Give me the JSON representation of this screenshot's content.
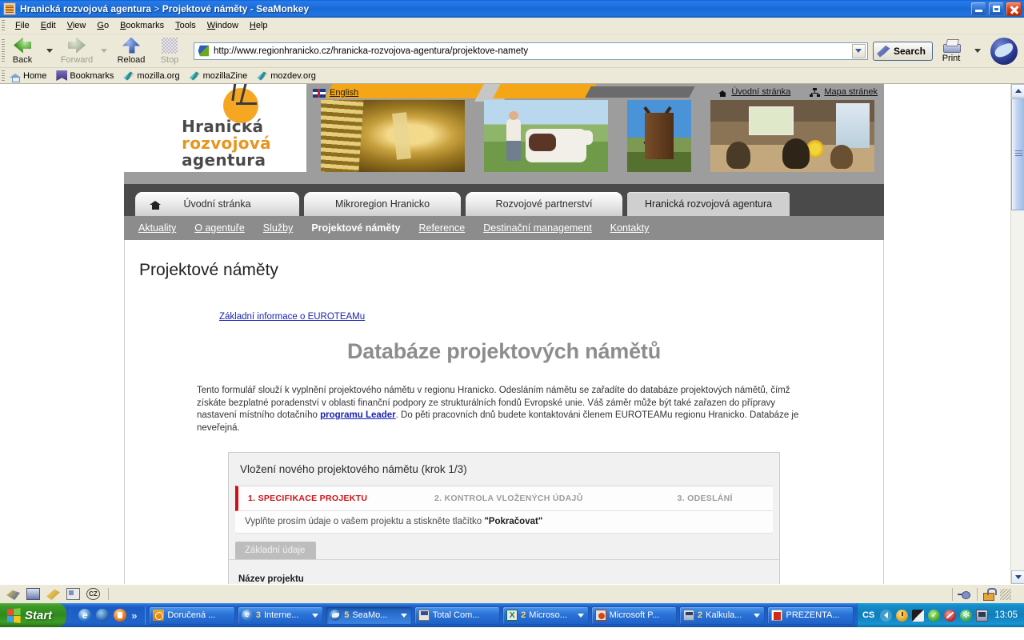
{
  "window": {
    "title_main": "Hranická rozvojová agentura",
    "title_sep": " > ",
    "title_page": "Projektové náměty - SeaMonkey",
    "icon": "app-icon"
  },
  "menubar": {
    "items": [
      {
        "label": "File"
      },
      {
        "label": "Edit"
      },
      {
        "label": "View"
      },
      {
        "label": "Go"
      },
      {
        "label": "Bookmarks"
      },
      {
        "label": "Tools"
      },
      {
        "label": "Window"
      },
      {
        "label": "Help"
      }
    ]
  },
  "toolbar": {
    "back": "Back",
    "forward": "Forward",
    "reload": "Reload",
    "stop": "Stop",
    "url": "http://www.regionhranicko.cz/hranicka-rozvojova-agentura/projektove-namety",
    "search": "Search",
    "print": "Print"
  },
  "bookmarks": {
    "items": [
      {
        "label": "Home",
        "icon": "home-icon"
      },
      {
        "label": "Bookmarks",
        "icon": "bookmark-icon"
      },
      {
        "label": "mozilla.org",
        "icon": "pencil-icon"
      },
      {
        "label": "mozillaZine",
        "icon": "pencil-icon"
      },
      {
        "label": "mozdev.org",
        "icon": "pencil-icon"
      }
    ]
  },
  "site": {
    "logo": {
      "line1": "Hranická",
      "line2": "rozvojová",
      "line3": "agentura"
    },
    "language_link": "English",
    "top_links": [
      {
        "label": "Úvodní stránka",
        "icon": "home-icon"
      },
      {
        "label": "Mapa stránek",
        "icon": "sitemap-icon"
      }
    ],
    "tabs": [
      {
        "label": "Úvodní stránka",
        "active": false,
        "icon": "home-icon"
      },
      {
        "label": "Mikroregion Hranicko",
        "active": false
      },
      {
        "label": "Rozvojové partnerství",
        "active": false
      },
      {
        "label": "Hranická rozvojová agentura",
        "active": true
      }
    ],
    "subnav": [
      {
        "label": "Aktuality",
        "current": false
      },
      {
        "label": "O agentuře",
        "current": false
      },
      {
        "label": "Služby",
        "current": false
      },
      {
        "label": "Projektové náměty",
        "current": true
      },
      {
        "label": "Reference",
        "current": false
      },
      {
        "label": "Destinační management",
        "current": false
      },
      {
        "label": "Kontakty",
        "current": false
      }
    ]
  },
  "content": {
    "page_heading": "Projektové náměty",
    "euroteam_link": "Základní informace o EUROTEAMu",
    "big_title": "Databáze projektových námětů",
    "intro_part1": "Tento formulář slouží k vyplnění projektového námětu v regionu Hranicko. Odesláním námětu se zařadíte do databáze projektových námětů, čímž získáte bezplatné poradenství v oblasti finanční podpory ze strukturálních fondů Evropské unie. Váš záměr může být také zařazen do přípravy nastavení místního dotačního ",
    "intro_link": "programu Leader",
    "intro_part2": ". Do pěti pracovních dnů budete kontaktováni členem EUROTEAMu regionu Hranicko. Databáze je neveřejná.",
    "form": {
      "box_heading": "Vložení nového projektového námětu (krok 1/3)",
      "steps": [
        {
          "label": "1. SPECIFIKACE PROJEKTU",
          "active": true
        },
        {
          "label": "2. KONTROLA VLOŽENÝCH ÚDAJŮ",
          "active": false
        },
        {
          "label": "3. ODESLÁNÍ",
          "active": false
        }
      ],
      "hint_prefix": "Vyplňte prosím údaje o vašem projektu a stiskněte tlačítko ",
      "hint_button": "\"Pokračovat\"",
      "section_tab": "Základní údaje",
      "field_label": "Název projektu",
      "field_value": "",
      "field_placeholder": ""
    }
  },
  "statusbar": {
    "icons": [
      "navigator-icon",
      "mail-icon",
      "composer-icon",
      "addressbook-icon",
      "cz-icon"
    ],
    "right_icons": [
      "connection-icon",
      "security-lock-icon",
      "resize-grip-icon"
    ]
  },
  "taskbar": {
    "start": "Start",
    "quicklaunch": [
      "ie-icon",
      "firefox-icon",
      "media-icon",
      "more-chevron"
    ],
    "tasks": [
      {
        "count": "",
        "label": "Doručená ...",
        "icon": "outlook-icon",
        "active": false,
        "dropdown": false
      },
      {
        "count": "3",
        "label": "Interne...",
        "icon": "ie-icon",
        "active": false,
        "dropdown": true
      },
      {
        "count": "5",
        "label": "SeaMo...",
        "icon": "seamonkey-icon",
        "active": true,
        "dropdown": true
      },
      {
        "count": "",
        "label": "Total Com...",
        "icon": "totalcommander-icon",
        "active": false,
        "dropdown": false
      },
      {
        "count": "2",
        "label": "Microso...",
        "icon": "excel-icon",
        "active": false,
        "dropdown": true
      },
      {
        "count": "",
        "label": "Microsoft P...",
        "icon": "powerpoint-icon",
        "active": false,
        "dropdown": false
      },
      {
        "count": "2",
        "label": "Kalkula...",
        "icon": "calculator-icon",
        "active": false,
        "dropdown": true
      },
      {
        "count": "",
        "label": "PREZENTA...",
        "icon": "pdf-icon",
        "active": false,
        "dropdown": false
      }
    ],
    "tray": {
      "language": "CS",
      "icons": [
        "show-hidden-arrow",
        "clock-icon",
        "keyboard-icon",
        "antivirus-icon",
        "block-icon",
        "update-icon",
        "network-icon"
      ],
      "clock": "13:05"
    }
  },
  "colors": {
    "accent_orange": "#e8951d",
    "step_active_red": "#cf1016",
    "link_blue": "#1a23b8",
    "nav_grey": "#8c8c8c",
    "tabbar_dark": "#4a4a4a"
  }
}
